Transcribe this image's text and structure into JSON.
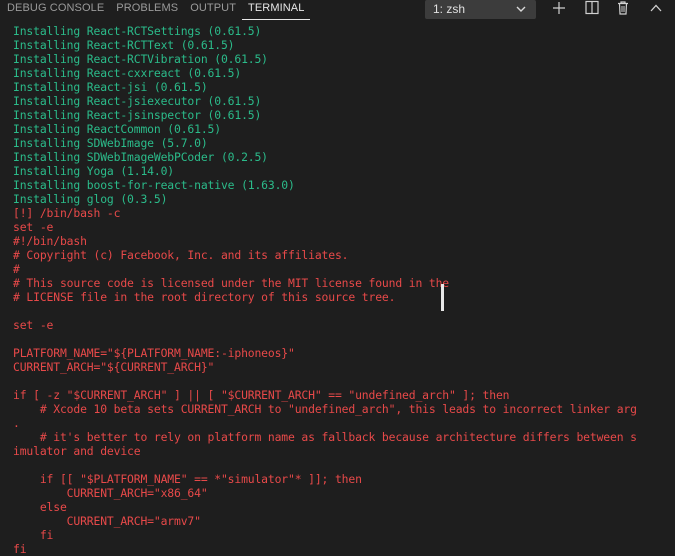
{
  "tabs": [
    {
      "label": "DEBUG CONSOLE",
      "active": false
    },
    {
      "label": "PROBLEMS",
      "active": false
    },
    {
      "label": "OUTPUT",
      "active": false
    },
    {
      "label": "TERMINAL",
      "active": true
    }
  ],
  "terminal_selector": {
    "value": "1: zsh"
  },
  "toolbar": {
    "icons": [
      "plus-icon",
      "split-terminal-icon",
      "trash-icon",
      "chevron-up-icon"
    ]
  },
  "colors": {
    "green": "#2bbb8a",
    "red": "#e74949",
    "background": "#1e1e1e"
  },
  "terminal_lines": [
    {
      "text": "Installing React-RCTSettings (0.61.5)",
      "color": "green"
    },
    {
      "text": "Installing React-RCTText (0.61.5)",
      "color": "green"
    },
    {
      "text": "Installing React-RCTVibration (0.61.5)",
      "color": "green"
    },
    {
      "text": "Installing React-cxxreact (0.61.5)",
      "color": "green"
    },
    {
      "text": "Installing React-jsi (0.61.5)",
      "color": "green"
    },
    {
      "text": "Installing React-jsiexecutor (0.61.5)",
      "color": "green"
    },
    {
      "text": "Installing React-jsinspector (0.61.5)",
      "color": "green"
    },
    {
      "text": "Installing ReactCommon (0.61.5)",
      "color": "green"
    },
    {
      "text": "Installing SDWebImage (5.7.0)",
      "color": "green"
    },
    {
      "text": "Installing SDWebImageWebPCoder (0.2.5)",
      "color": "green"
    },
    {
      "text": "Installing Yoga (1.14.0)",
      "color": "green"
    },
    {
      "text": "Installing boost-for-react-native (1.63.0)",
      "color": "green"
    },
    {
      "text": "Installing glog (0.3.5)",
      "color": "green"
    },
    {
      "text": "[!] /bin/bash -c",
      "color": "red"
    },
    {
      "text": "set -e",
      "color": "red"
    },
    {
      "text": "#!/bin/bash",
      "color": "red"
    },
    {
      "text": "# Copyright (c) Facebook, Inc. and its affiliates.",
      "color": "red"
    },
    {
      "text": "#",
      "color": "red"
    },
    {
      "text": "# This source code is licensed under the MIT license found in the",
      "color": "red"
    },
    {
      "text": "# LICENSE file in the root directory of this source tree.",
      "color": "red"
    },
    {
      "text": "",
      "color": "red"
    },
    {
      "text": "set -e",
      "color": "red"
    },
    {
      "text": "",
      "color": "red"
    },
    {
      "text": "PLATFORM_NAME=\"${PLATFORM_NAME:-iphoneos}\"",
      "color": "red"
    },
    {
      "text": "CURRENT_ARCH=\"${CURRENT_ARCH}\"",
      "color": "red"
    },
    {
      "text": "",
      "color": "red"
    },
    {
      "text": "if [ -z \"$CURRENT_ARCH\" ] || [ \"$CURRENT_ARCH\" == \"undefined_arch\" ]; then",
      "color": "red"
    },
    {
      "text": "    # Xcode 10 beta sets CURRENT_ARCH to \"undefined_arch\", this leads to incorrect linker arg",
      "color": "red"
    },
    {
      "text": ".",
      "color": "red"
    },
    {
      "text": "    # it's better to rely on platform name as fallback because architecture differs between s",
      "color": "red"
    },
    {
      "text": "imulator and device",
      "color": "red"
    },
    {
      "text": "",
      "color": "red"
    },
    {
      "text": "    if [[ \"$PLATFORM_NAME\" == *\"simulator\"* ]]; then",
      "color": "red"
    },
    {
      "text": "        CURRENT_ARCH=\"x86_64\"",
      "color": "red"
    },
    {
      "text": "    else",
      "color": "red"
    },
    {
      "text": "        CURRENT_ARCH=\"armv7\"",
      "color": "red"
    },
    {
      "text": "    fi",
      "color": "red"
    },
    {
      "text": "fi",
      "color": "red"
    }
  ]
}
